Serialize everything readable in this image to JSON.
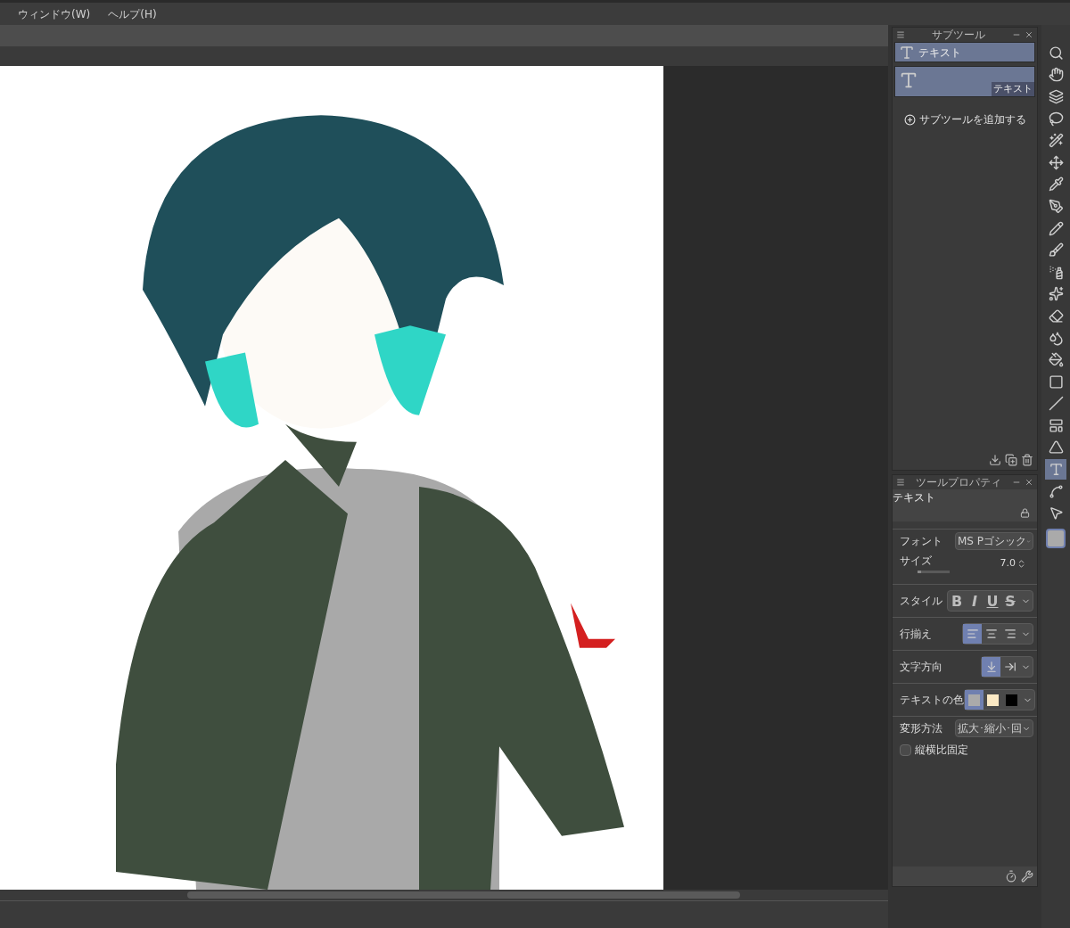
{
  "menu": [
    "ウィンドウ(W)",
    "ヘルプ(H)"
  ],
  "canvas": {
    "kind": "picture"
  },
  "subtool": {
    "title": "サブツール",
    "groups": [
      {
        "label": "テキスト",
        "selected": true
      }
    ],
    "items": [
      {
        "label": "テキスト",
        "selected": true
      }
    ],
    "add": "サブツールを追加する"
  },
  "tool_property": {
    "title": "ツールプロパティ",
    "tool_name": "テキスト",
    "rows": [
      {
        "kind": "dropdown",
        "label": "フォント",
        "value": "MS Pゴシック"
      },
      {
        "kind": "slider",
        "label": "サイズ",
        "value": "7.0",
        "level": 0.1
      },
      {
        "kind": "style",
        "label": "スタイル",
        "options": [
          {
            "label": "B",
            "selected": false
          },
          {
            "label": "I",
            "selected": false
          },
          {
            "label": "U",
            "selected": false
          },
          {
            "label": "S",
            "selected": false
          }
        ]
      },
      {
        "kind": "align",
        "label": "行揃え",
        "options": [
          {
            "selected": true
          },
          {
            "selected": false
          },
          {
            "selected": false
          }
        ]
      },
      {
        "kind": "direction",
        "label": "文字方向",
        "options": [
          {
            "selected": true
          },
          {
            "selected": false
          }
        ]
      },
      {
        "kind": "colors",
        "label": "テキストの色",
        "options": [
          {
            "color": "#aaaaaa",
            "selected": true
          },
          {
            "color": "#fbe9c4",
            "selected": false
          },
          {
            "color": "#000000",
            "selected": false
          }
        ]
      },
      {
        "kind": "dropdown",
        "label": "変形方法",
        "value": "拡大･縮小･回"
      },
      {
        "kind": "checkbox",
        "label": "縦横比固定",
        "checked": false
      }
    ]
  },
  "tools": [
    {
      "selected": false
    },
    {
      "selected": false
    },
    {
      "selected": false
    },
    {
      "selected": false
    },
    {
      "selected": false
    },
    {
      "selected": false
    },
    {
      "selected": false
    },
    {
      "selected": false
    },
    {
      "selected": false
    },
    {
      "selected": false
    },
    {
      "selected": false
    },
    {
      "selected": false
    },
    {
      "selected": false
    },
    {
      "selected": false
    },
    {
      "selected": false
    },
    {
      "selected": false
    },
    {
      "selected": false
    },
    {
      "selected": false
    },
    {
      "selected": false
    },
    {
      "selected": true
    },
    {
      "selected": false
    },
    {
      "selected": false
    }
  ]
}
